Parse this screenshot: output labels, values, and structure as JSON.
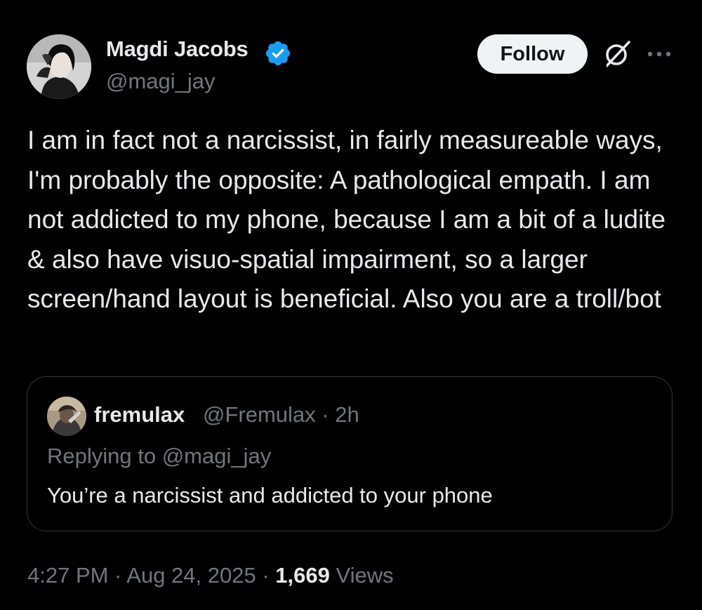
{
  "author": {
    "name": "Magdi Jacobs",
    "handle": "@magi_jay",
    "verified": true
  },
  "header_actions": {
    "follow_label": "Follow",
    "grok_icon": "grok-icon",
    "more_icon": "more-options-icon"
  },
  "tweet": {
    "text": "I am in fact not a narcissist, in fairly measureable ways, I'm probably the opposite: A pathological empath. I am not addicted to my phone, because I am a bit of a ludite & also have visuo-spatial impairment, so a larger screen/hand layout is beneficial. Also you are a troll/bot"
  },
  "quoted_tweet": {
    "name": "fremulax",
    "handle_time": "@Fremulax · 2h",
    "replying_to": "Replying to @magi_jay",
    "text": "You’re a narcissist and addicted to your phone"
  },
  "meta": {
    "time_date": "4:27 PM · Aug 24, 2025 · ",
    "views_count": "1,669",
    "views_label": " Views"
  },
  "colors": {
    "background": "#000000",
    "primary_text": "#e7e9ea",
    "secondary_text": "#71767b",
    "verified_blue": "#1d9bf0",
    "border": "#333639",
    "follow_button_bg": "#eff3f4"
  }
}
